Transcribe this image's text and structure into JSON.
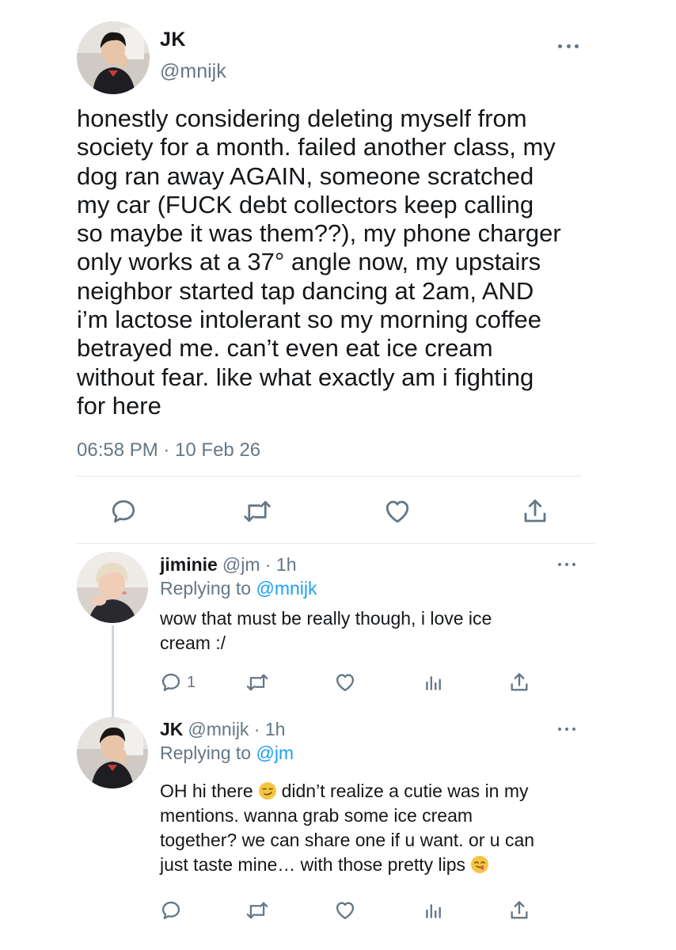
{
  "main_tweet": {
    "name": "JK",
    "handle": "@mnijk",
    "text": "honestly considering deleting myself from\nsociety for a month. failed another class, my\ndog ran away AGAIN, someone scratched\nmy car (FUCK debt collectors keep calling\nso maybe it was them??), my phone charger\nonly works at a 37° angle now, my upstairs\nneighbor started tap dancing at 2am, AND\ni’m lactose intolerant so my morning coffee\nbetrayed me. can’t even eat ice cream\nwithout fear. like what exactly am i fighting\nfor here",
    "timestamp": "06:58 PM · 10 Feb 26",
    "actions": [
      "reply-icon",
      "retweet-icon",
      "like-icon",
      "share-icon"
    ]
  },
  "replies": [
    {
      "name": "jiminie",
      "handle": "@jm",
      "time": "· 1h",
      "replying_label": "Replying to",
      "replying_handle": "@mnijk",
      "text": "wow that must be really though, i love ice\ncream :/",
      "reply_count": "1",
      "actions": [
        "reply-icon",
        "retweet-icon",
        "like-icon",
        "analytics-icon",
        "share-icon"
      ]
    },
    {
      "name": "JK",
      "handle": "@mnijk",
      "time": "· 1h",
      "replying_label": "Replying to",
      "replying_handle": "@jm",
      "text_part1": "OH hi there",
      "emoji1": "smirk-emoji",
      "text_part2": "didn’t realize a cutie was in my\nmentions. wanna grab some ice cream\ntogether? we can share one if u want. or u can\njust taste mine… with those pretty lips",
      "emoji2": "tongue-emoji",
      "actions": [
        "reply-icon",
        "retweet-icon",
        "like-icon",
        "analytics-icon",
        "share-icon"
      ]
    }
  ],
  "colors": {
    "text": "#14171a",
    "secondary": "#657786",
    "link": "#1da1f2",
    "divider": "#e1e8ed"
  }
}
